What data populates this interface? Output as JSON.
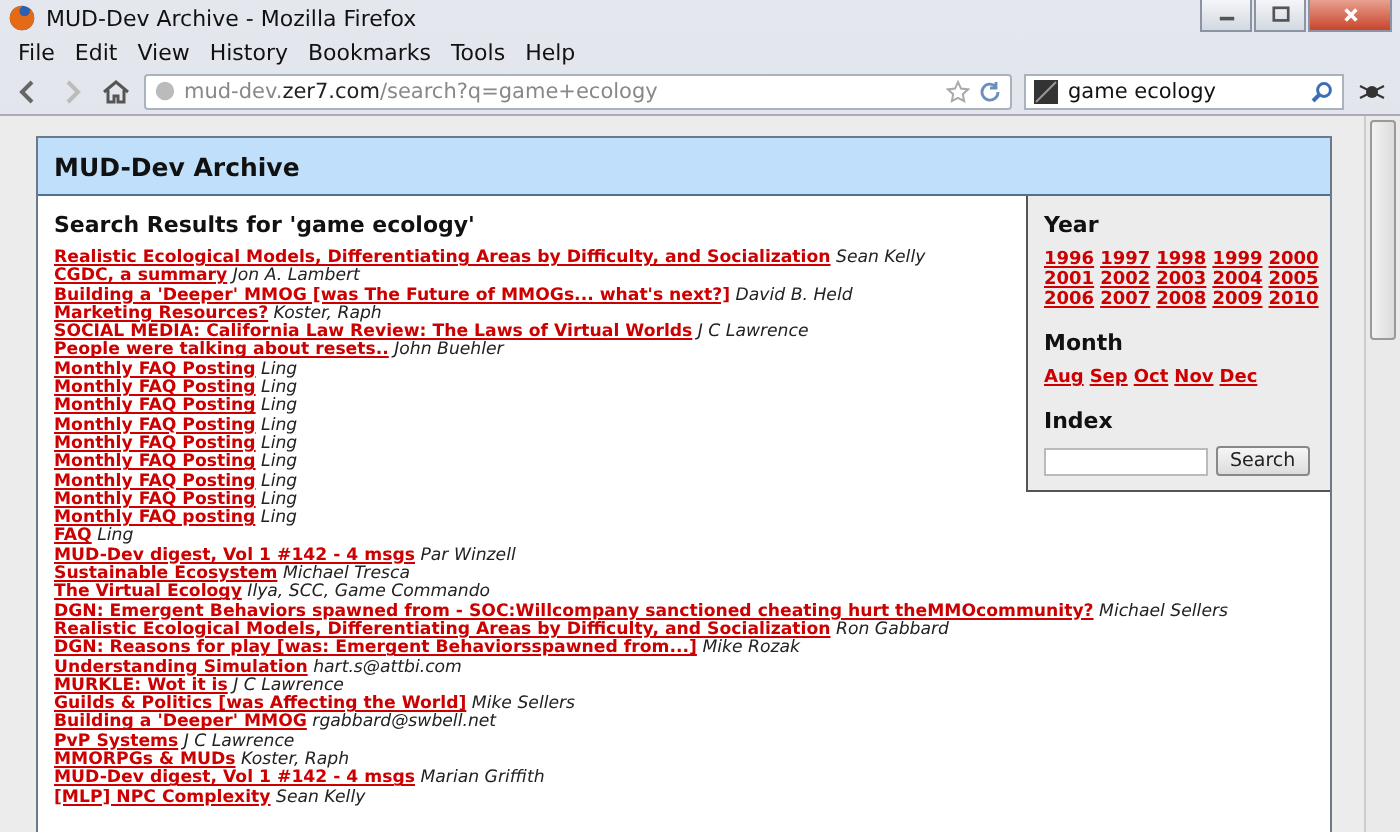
{
  "window": {
    "title": "MUD-Dev Archive - Mozilla Firefox"
  },
  "menu": [
    "File",
    "Edit",
    "View",
    "History",
    "Bookmarks",
    "Tools",
    "Help"
  ],
  "address": {
    "prefix": "mud-dev.",
    "domain": "zer7.com",
    "path": "/search?q=game+ecology"
  },
  "search_bar": {
    "value": "game ecology"
  },
  "page": {
    "title": "MUD-Dev Archive",
    "results_heading": "Search Results for 'game ecology'",
    "results": [
      {
        "title": "Realistic Ecological Models, Differentiating Areas by Difficulty, and Socialization",
        "author": "Sean Kelly"
      },
      {
        "title": "CGDC, a summary",
        "author": "Jon A. Lambert"
      },
      {
        "title": "Building a 'Deeper' MMOG [was The Future of MMOGs... what's next?]",
        "author": "David B. Held"
      },
      {
        "title": "Marketing Resources?",
        "author": "Koster, Raph"
      },
      {
        "title": "SOCIAL MEDIA: California Law Review: The Laws of Virtual Worlds",
        "author": "J C Lawrence"
      },
      {
        "title": "People were talking about resets..",
        "author": "John Buehler"
      },
      {
        "title": "Monthly FAQ Posting",
        "author": "Ling"
      },
      {
        "title": "Monthly FAQ Posting",
        "author": "Ling"
      },
      {
        "title": "Monthly FAQ Posting",
        "author": "Ling"
      },
      {
        "title": "Monthly FAQ Posting",
        "author": "Ling"
      },
      {
        "title": "Monthly FAQ Posting",
        "author": "Ling"
      },
      {
        "title": "Monthly FAQ Posting",
        "author": "Ling"
      },
      {
        "title": "Monthly FAQ Posting",
        "author": "Ling"
      },
      {
        "title": "Monthly FAQ Posting",
        "author": "Ling"
      },
      {
        "title": "Monthly FAQ posting",
        "author": "Ling"
      },
      {
        "title": "FAQ",
        "author": "Ling"
      },
      {
        "title": "MUD-Dev digest, Vol 1 #142 - 4 msgs",
        "author": "Par Winzell"
      },
      {
        "title": "Sustainable Ecosystem",
        "author": "Michael Tresca"
      },
      {
        "title": "The Virtual Ecology",
        "author": "Ilya, SCC, Game Commando"
      },
      {
        "title": "DGN: Emergent Behaviors spawned from - SOC:Willcompany sanctioned cheating hurt theMMOcommunity?",
        "author": "Michael Sellers"
      },
      {
        "title": "Realistic Ecological Models, Differentiating Areas by Difficulty, and Socialization",
        "author": "Ron Gabbard"
      },
      {
        "title": "DGN: Reasons for play [was: Emergent Behaviorsspawned from...]",
        "author": "Mike Rozak"
      },
      {
        "title": "Understanding Simulation",
        "author": "hart.s@attbi.com"
      },
      {
        "title": "MURKLE: Wot it is",
        "author": "J C Lawrence"
      },
      {
        "title": "Guilds & Politics [was Affecting the World]",
        "author": "Mike Sellers"
      },
      {
        "title": "Building a 'Deeper' MMOG",
        "author": "rgabbard@swbell.net"
      },
      {
        "title": "PvP Systems",
        "author": "J C Lawrence"
      },
      {
        "title": "MMORPGs & MUDs",
        "author": "Koster, Raph"
      },
      {
        "title": "MUD-Dev digest, Vol 1 #142 - 4 msgs",
        "author": "Marian Griffith"
      },
      {
        "title": "[MLP] NPC Complexity",
        "author": "Sean Kelly"
      }
    ],
    "sidebar": {
      "year_heading": "Year",
      "years": [
        "1996",
        "1997",
        "1998",
        "1999",
        "2000",
        "2001",
        "2002",
        "2003",
        "2004",
        "2005",
        "2006",
        "2007",
        "2008",
        "2009",
        "2010"
      ],
      "month_heading": "Month",
      "months": [
        "Aug",
        "Sep",
        "Oct",
        "Nov",
        "Dec"
      ],
      "index_heading": "Index",
      "search_button": "Search"
    }
  }
}
